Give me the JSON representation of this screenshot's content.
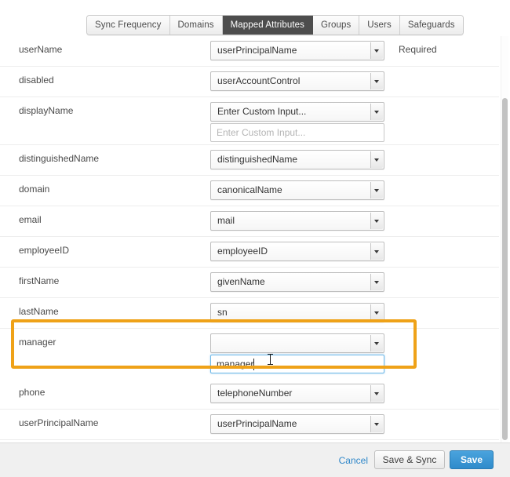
{
  "tabs": [
    {
      "label": "Sync Frequency",
      "active": false
    },
    {
      "label": "Domains",
      "active": false
    },
    {
      "label": "Mapped Attributes",
      "active": true
    },
    {
      "label": "Groups",
      "active": false
    },
    {
      "label": "Users",
      "active": false
    },
    {
      "label": "Safeguards",
      "active": false
    }
  ],
  "colors": {
    "active_tab_bg": "#4d4d4d",
    "highlight_border": "#efa218",
    "focus_border": "#6fb9e8",
    "save_button": "#2f8bcb",
    "cancel_link": "#2f87c9"
  },
  "rows": [
    {
      "label": "userName",
      "select_value": "userPrincipalName",
      "has_input": false,
      "note": "Required"
    },
    {
      "label": "disabled",
      "select_value": "userAccountControl",
      "has_input": false,
      "note": ""
    },
    {
      "label": "displayName",
      "select_value": "Enter Custom Input...",
      "has_input": true,
      "input_value": "",
      "input_placeholder": "Enter Custom Input...",
      "input_focused": false,
      "note": ""
    },
    {
      "label": "distinguishedName",
      "select_value": "distinguishedName",
      "has_input": false,
      "note": ""
    },
    {
      "label": "domain",
      "select_value": "canonicalName",
      "has_input": false,
      "note": ""
    },
    {
      "label": "email",
      "select_value": "mail",
      "has_input": false,
      "note": ""
    },
    {
      "label": "employeeID",
      "select_value": "employeeID",
      "has_input": false,
      "note": ""
    },
    {
      "label": "firstName",
      "select_value": "givenName",
      "has_input": false,
      "note": ""
    },
    {
      "label": "lastName",
      "select_value": "sn",
      "has_input": false,
      "note": ""
    },
    {
      "label": "manager",
      "select_value": "",
      "has_input": true,
      "input_value": "manager",
      "input_placeholder": "",
      "input_focused": true,
      "highlighted": true,
      "note": ""
    },
    {
      "label": "phone",
      "select_value": "telephoneNumber",
      "has_input": false,
      "note": ""
    },
    {
      "label": "userPrincipalName",
      "select_value": "userPrincipalName",
      "has_input": false,
      "note": ""
    }
  ],
  "footer": {
    "cancel_label": "Cancel",
    "save_sync_label": "Save & Sync",
    "save_label": "Save"
  }
}
